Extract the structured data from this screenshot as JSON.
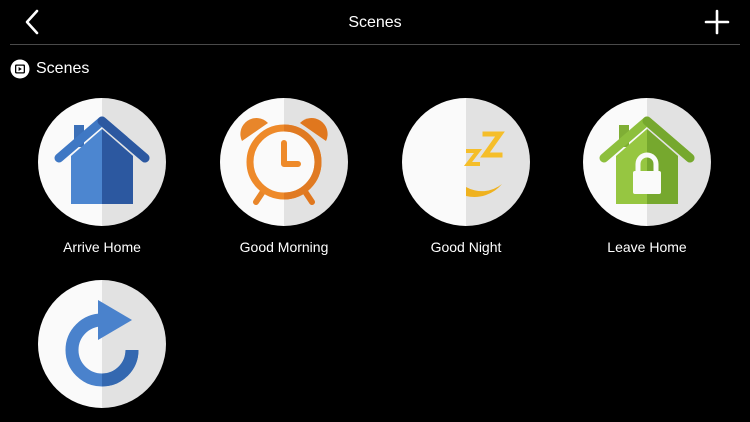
{
  "navbar": {
    "title": "Scenes",
    "back_icon": "chevron-left-icon",
    "add_icon": "plus-icon"
  },
  "section": {
    "label": "Scenes",
    "icon": "scene-play-icon"
  },
  "scenes": [
    {
      "label": "Arrive Home",
      "icon": "house-icon"
    },
    {
      "label": "Good Morning",
      "icon": "alarm-clock-icon"
    },
    {
      "label": "Good Night",
      "icon": "moon-sleep-icon"
    },
    {
      "label": "Leave Home",
      "icon": "house-lock-icon"
    },
    {
      "label": "",
      "icon": "refresh-arrow-icon"
    }
  ],
  "colors": {
    "background": "#000000",
    "divider": "#4a4a4a",
    "house_blue": "#3f78c4",
    "alarm_orange": "#ee8a2a",
    "moon_yellow": "#f8c938",
    "lock_green": "#8dbf3d",
    "refresh_blue": "#4a82cc"
  }
}
